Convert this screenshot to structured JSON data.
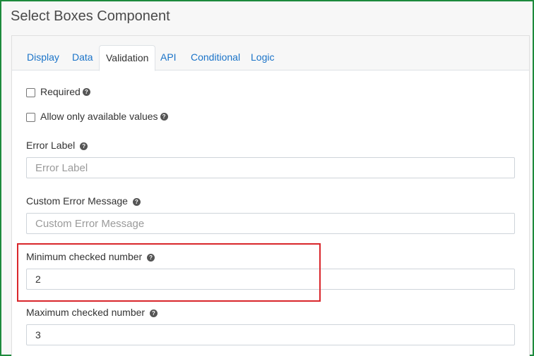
{
  "window": {
    "title": "Select Boxes Component"
  },
  "tabs": [
    {
      "label": "Display"
    },
    {
      "label": "Data"
    },
    {
      "label": "Validation"
    },
    {
      "label": "API"
    },
    {
      "label": "Conditional"
    },
    {
      "label": "Logic"
    }
  ],
  "active_tab": "Validation",
  "validation": {
    "required": {
      "label": "Required",
      "checked": false
    },
    "only_available": {
      "label": "Allow only available values",
      "checked": false
    },
    "error_label": {
      "label": "Error Label",
      "placeholder": "Error Label",
      "value": ""
    },
    "custom_error": {
      "label": "Custom Error Message",
      "placeholder": "Custom Error Message",
      "value": ""
    },
    "min_checked": {
      "label": "Minimum checked number",
      "value": "2"
    },
    "max_checked": {
      "label": "Maximum checked number",
      "value": "3"
    }
  },
  "icons": {
    "help": "question-circle-icon"
  },
  "colors": {
    "frame_border": "#1d8a3c",
    "tab_link": "#1a73c8",
    "highlight": "#d9262b"
  }
}
